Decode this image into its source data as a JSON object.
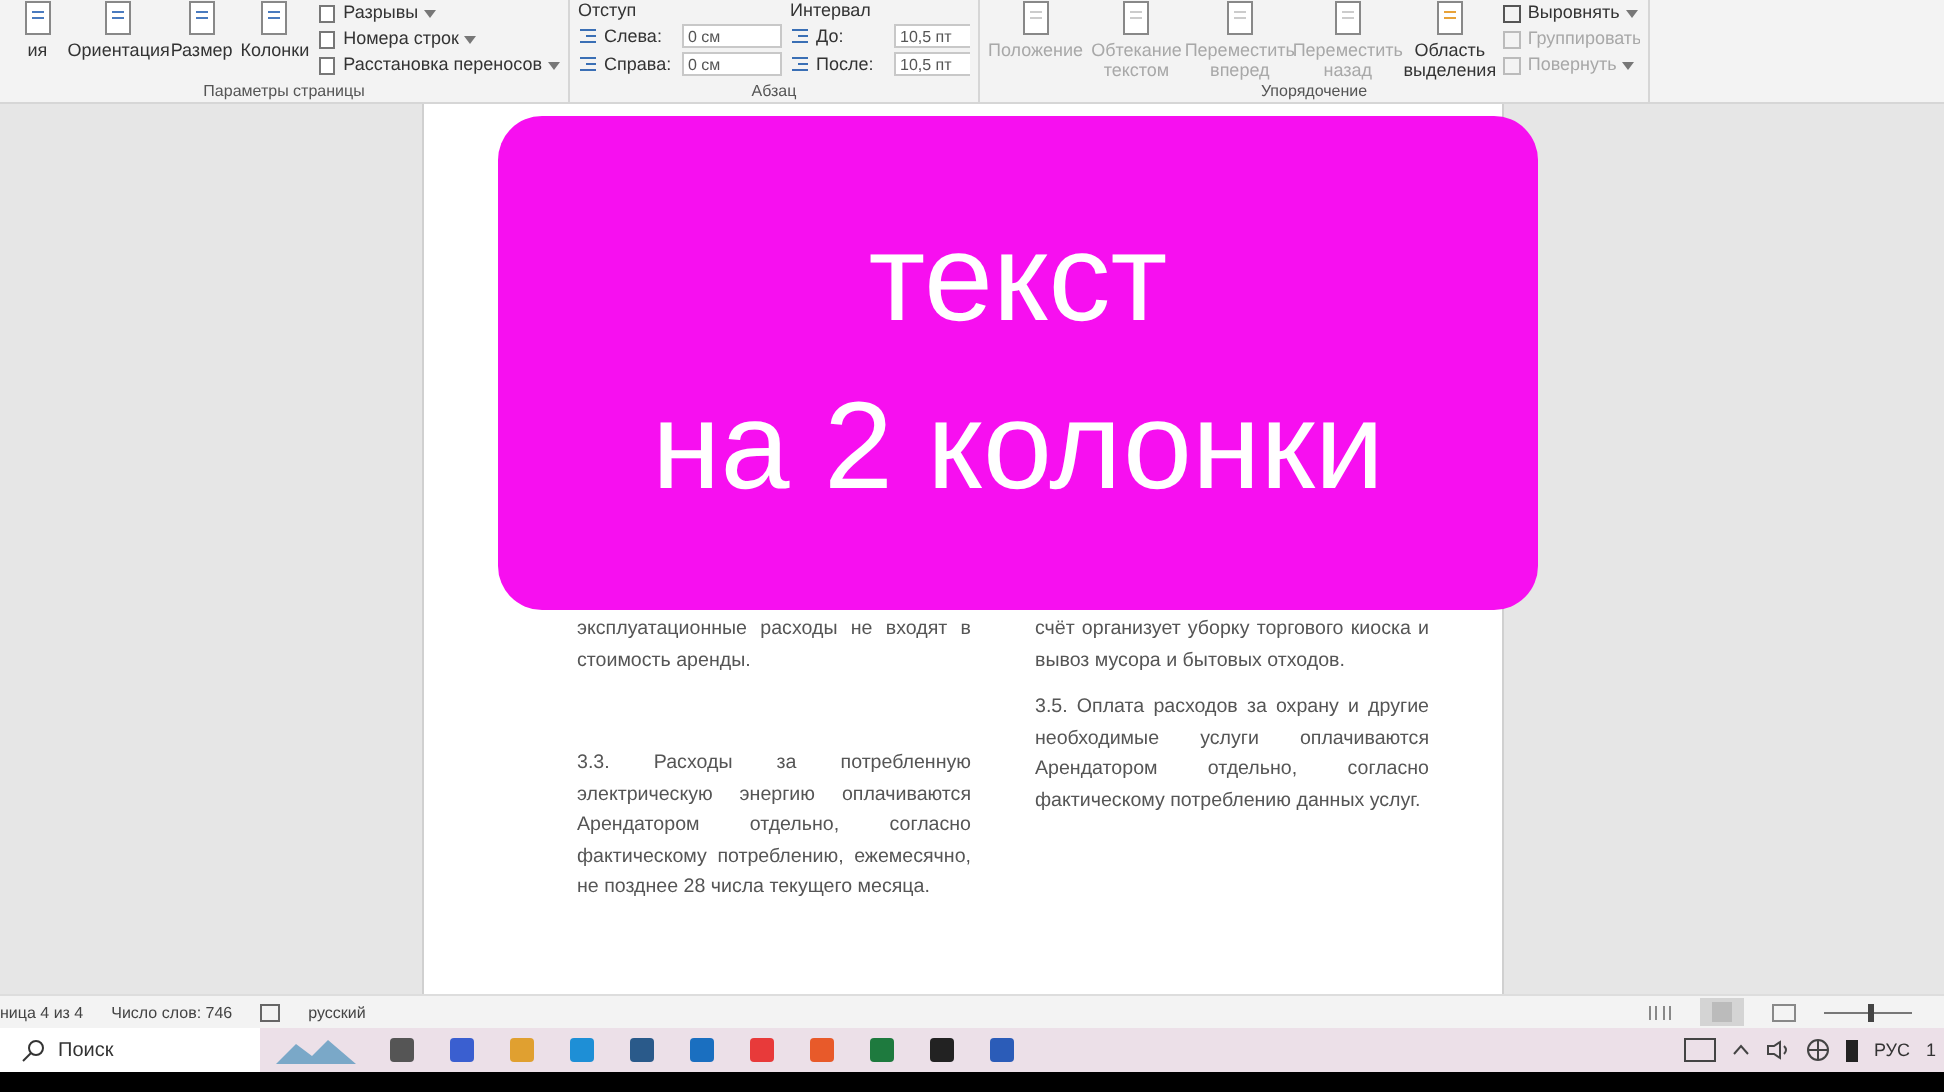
{
  "ribbon": {
    "groups": [
      {
        "kind": "page",
        "label": "Параметры страницы",
        "large": [
          "ия",
          "Ориентация",
          "Размер",
          "Колонки"
        ],
        "small": [
          "Разрывы",
          "Номера строк",
          "Расстановка переносов"
        ]
      },
      {
        "kind": "paragraph",
        "label": "Абзац",
        "indent_title": "Отступ",
        "spacing_title": "Интервал",
        "fields": [
          {
            "label": "Слева:",
            "value": "0 см"
          },
          {
            "label": "Справа:",
            "value": "0 см"
          },
          {
            "label": "До:",
            "value": "10,5 пт"
          },
          {
            "label": "После:",
            "value": "10,5 пт"
          }
        ]
      },
      {
        "kind": "arrange",
        "label": "Упорядочение",
        "large": [
          {
            "label": "Положение",
            "disabled": true
          },
          {
            "label": "Обтекание текстом",
            "disabled": true
          },
          {
            "label": "Переместить вперед",
            "disabled": true
          },
          {
            "label": "Переместить назад",
            "disabled": true
          },
          {
            "label": "Область выделения",
            "disabled": false
          }
        ],
        "small": [
          {
            "label": "Выровнять",
            "disabled": false
          },
          {
            "label": "Группировать",
            "disabled": true
          },
          {
            "label": "Повернуть",
            "disabled": true
          }
        ]
      }
    ]
  },
  "document": {
    "columns": [
      [
        "эксплуатационные расходы не входят в стоимость аренды.",
        "3.3. Расходы за потребленную электрическую энергию оплачиваются Арендатором отдельно, согласно фактическому потреблению, ежемесячно, не позднее 28 числа текущего месяца."
      ],
      [
        "счёт организует уборку торгового киоска и вывоз мусора и бытовых отходов.",
        "3.5. Оплата расходов за охрану и другие необходимые услуги оплачиваются Арендатором отдельно, согласно фактическому потреблению данных услуг."
      ]
    ]
  },
  "overlay": {
    "lines": [
      "текст",
      "на 2 колонки"
    ]
  },
  "status_bar": {
    "page": "ница 4 из 4",
    "words": "Число слов: 746",
    "language": "русский",
    "zoom": {
      "level": 0.5
    }
  },
  "taskbar": {
    "search_placeholder": "Поиск",
    "language": "РУС",
    "clock": "1"
  }
}
